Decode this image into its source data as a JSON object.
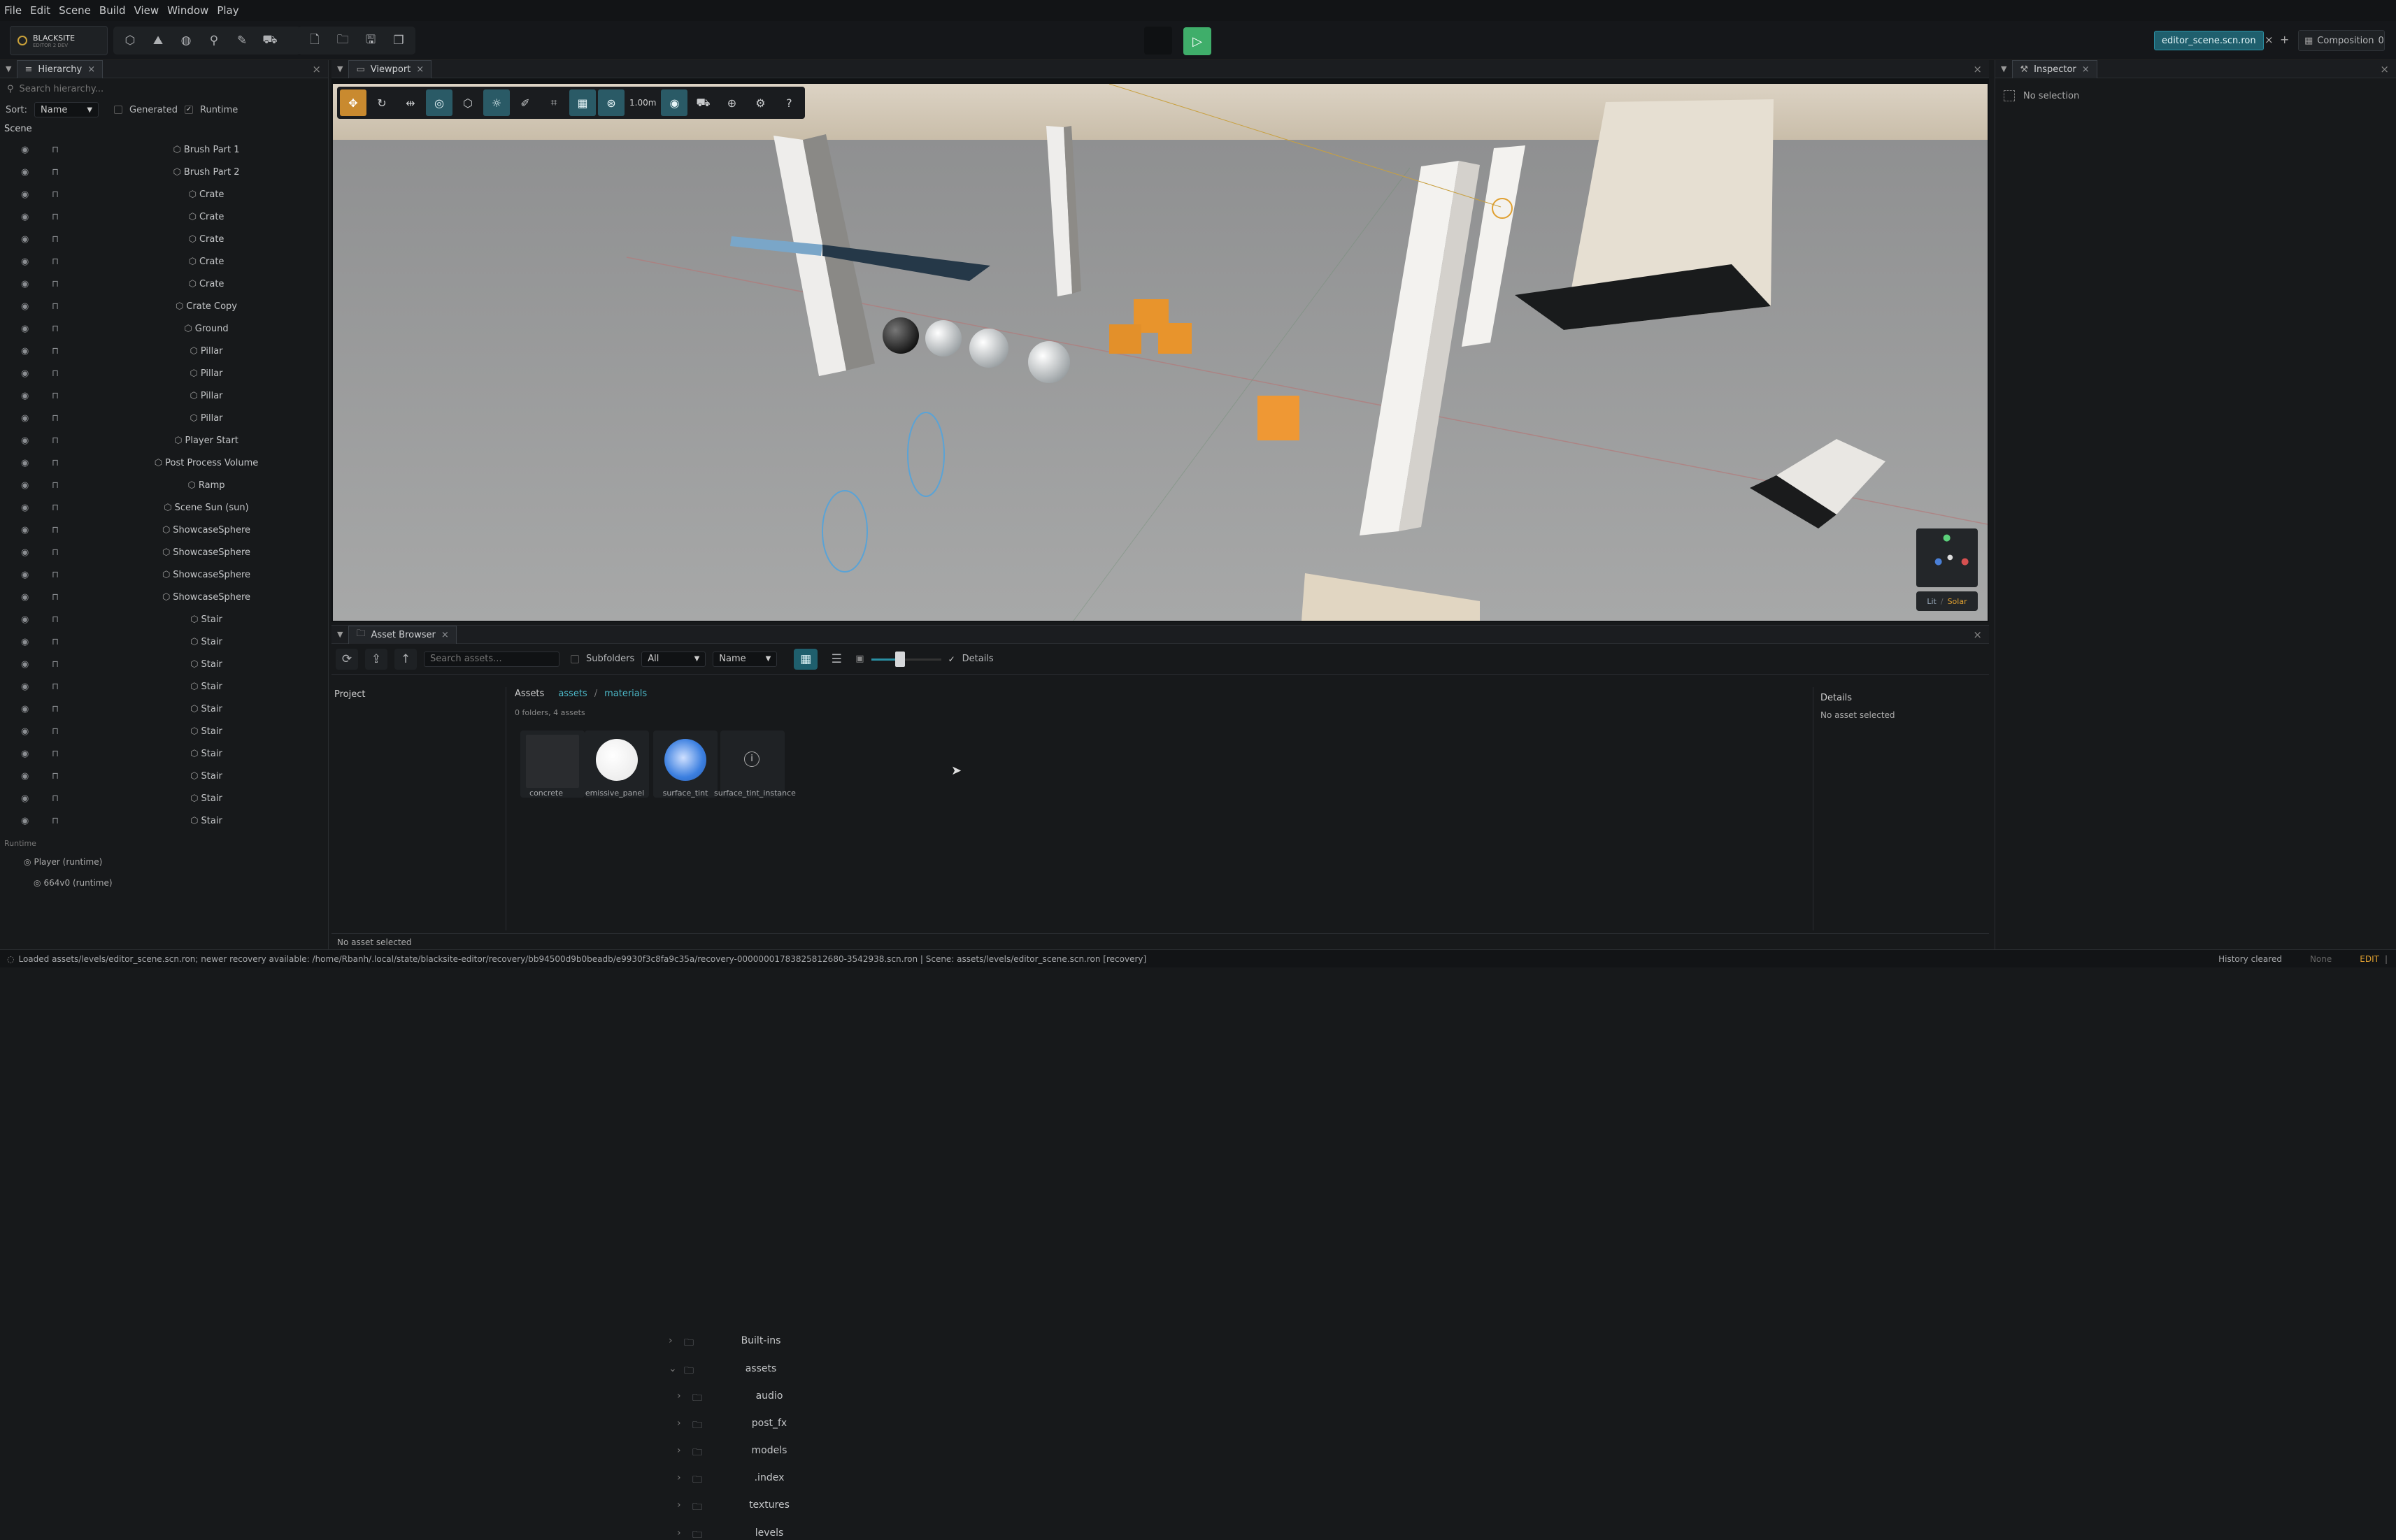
{
  "menubar": {
    "items": [
      "File",
      "Edit",
      "Scene",
      "Build",
      "View",
      "Window",
      "Play"
    ]
  },
  "toolbar": {
    "project_name": "BLACKSITE",
    "project_sub": "EDITOR 2 DEV",
    "scene_tab": "editor_scene.scn.ron",
    "composition_label": "Composition",
    "composition_count": "0"
  },
  "hierarchy": {
    "tab": "Hierarchy",
    "search_placeholder": "Search hierarchy...",
    "sort_label": "Sort:",
    "sort_value": "Name",
    "generated_label": "Generated",
    "runtime_label": "Runtime",
    "scene_label": "Scene",
    "items": [
      "Brush Part 1",
      "Brush Part 2",
      "Crate",
      "Crate",
      "Crate",
      "Crate",
      "Crate",
      "Crate Copy",
      "Ground",
      "Pillar",
      "Pillar",
      "Pillar",
      "Pillar",
      "Player Start",
      "Post Process Volume",
      "Ramp",
      "Scene Sun (sun)",
      "ShowcaseSphere",
      "ShowcaseSphere",
      "ShowcaseSphere",
      "ShowcaseSphere",
      "Stair",
      "Stair",
      "Stair",
      "Stair",
      "Stair",
      "Stair",
      "Stair",
      "Stair",
      "Stair",
      "Stair"
    ],
    "runtime_section": "Runtime",
    "runtime_items": [
      "Player (runtime)",
      "664v0 (runtime)"
    ]
  },
  "viewport": {
    "tab": "Viewport",
    "snap_value": "1.00m",
    "gizmo_modes": [
      "Lit",
      "Solar"
    ]
  },
  "inspector": {
    "tab": "Inspector",
    "empty": "No selection"
  },
  "asset_browser": {
    "tab": "Asset Browser",
    "search_placeholder": "Search assets...",
    "subfolders_label": "Subfolders",
    "filter_value": "All",
    "sort_value": "Name",
    "details_toggle": "Details",
    "project_label": "Project",
    "tree": [
      "Built-ins",
      "assets",
      "audio",
      "post_fx",
      "models",
      ".index",
      "textures",
      "levels"
    ],
    "breadcrumb_root": "Assets",
    "breadcrumb_parts": [
      "assets",
      "/",
      "materials"
    ],
    "counts": "0 folders, 4 assets",
    "assets": [
      {
        "name": "concrete",
        "thumb": "dark"
      },
      {
        "name": "emissive_panel",
        "thumb": "white"
      },
      {
        "name": "surface_tint",
        "thumb": "blue"
      },
      {
        "name": "surface_tint_instance",
        "thumb": "info"
      }
    ],
    "details_title": "Details",
    "details_empty": "No asset selected",
    "footer": "No asset selected"
  },
  "statusbar": {
    "message": "Loaded assets/levels/editor_scene.scn.ron; newer recovery available: /home/Rbanh/.local/state/blacksite-editor/recovery/bb94500d9b0beadb/e9930f3c8fa9c35a/recovery-00000001783825812680-3542938.scn.ron | Scene: assets/levels/editor_scene.scn.ron [recovery]",
    "history": "History cleared",
    "mode_none": "None",
    "mode": "EDIT"
  },
  "colors": {
    "accent": "#2a8fa3",
    "play": "#3fae6a",
    "selection": "#c98a2f"
  }
}
